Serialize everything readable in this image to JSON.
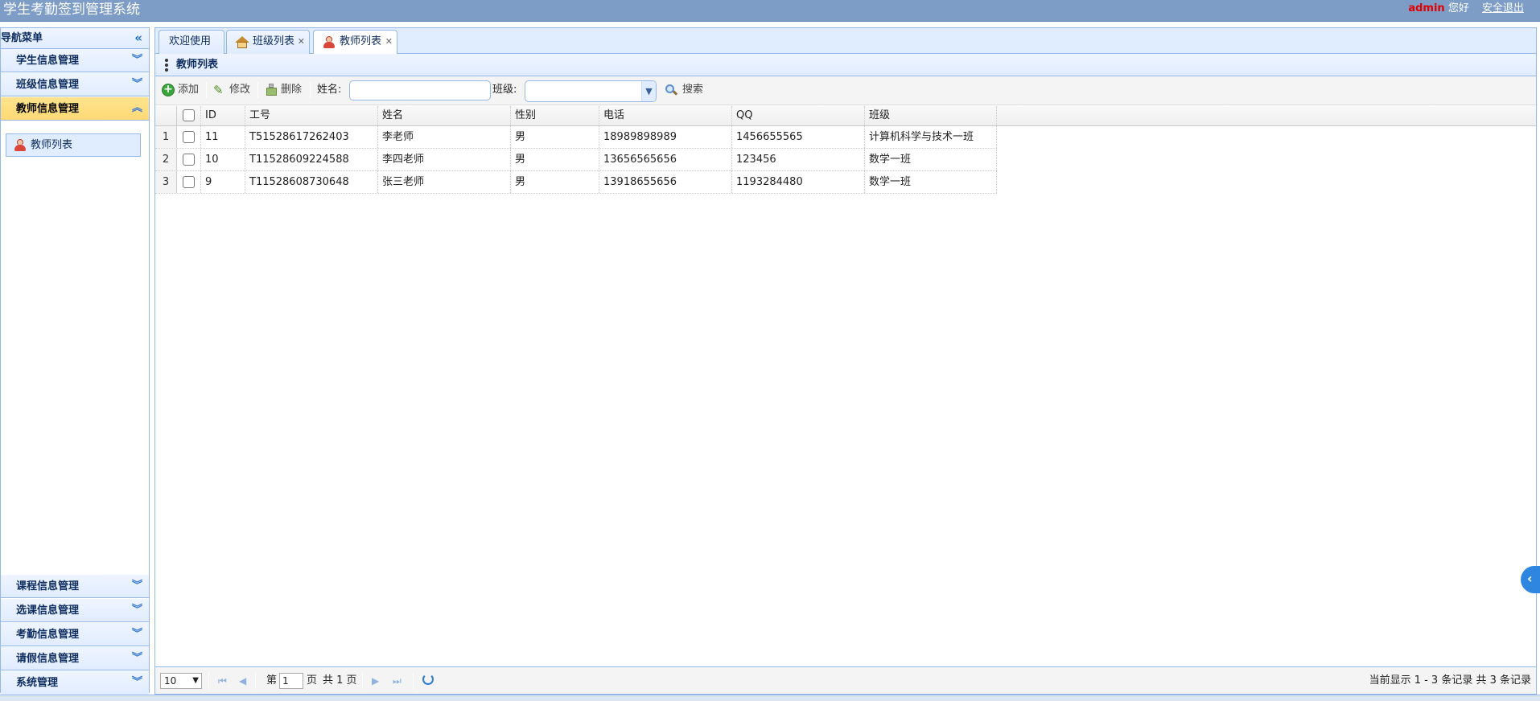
{
  "header": {
    "app_title": "学生考勤签到管理系统",
    "username": "admin",
    "greeting": "您好",
    "logout": "安全退出"
  },
  "nav": {
    "title": "导航菜单",
    "sections": [
      {
        "label": "学生信息管理"
      },
      {
        "label": "班级信息管理"
      },
      {
        "label": "教师信息管理",
        "active": true,
        "items": [
          {
            "label": "教师列表"
          }
        ]
      },
      {
        "label": "课程信息管理"
      },
      {
        "label": "选课信息管理"
      },
      {
        "label": "考勤信息管理"
      },
      {
        "label": "请假信息管理"
      },
      {
        "label": "系统管理"
      }
    ]
  },
  "tabs": [
    {
      "label": "欢迎使用",
      "closable": false
    },
    {
      "label": "班级列表",
      "closable": true,
      "icon": "house-icon"
    },
    {
      "label": "教师列表",
      "closable": true,
      "icon": "person-icon",
      "active": true
    }
  ],
  "panel": {
    "title": "教师列表"
  },
  "toolbar": {
    "add": "添加",
    "edit": "修改",
    "delete": "删除",
    "name_label": "姓名:",
    "name_value": "",
    "class_label": "班级:",
    "class_value": "",
    "search": "搜索"
  },
  "grid": {
    "columns": [
      "ID",
      "工号",
      "姓名",
      "性别",
      "电话",
      "QQ",
      "班级"
    ],
    "rows": [
      {
        "num": "1",
        "cells": [
          "11",
          "T51528617262403",
          "李老师",
          "男",
          "18989898989",
          "1456655565",
          "计算机科学与技术一班"
        ]
      },
      {
        "num": "2",
        "cells": [
          "10",
          "T11528609224588",
          "李四老师",
          "男",
          "13656565656",
          "123456",
          "数学一班"
        ]
      },
      {
        "num": "3",
        "cells": [
          "9",
          "T11528608730648",
          "张三老师",
          "男",
          "13918655656",
          "1193284480",
          "数学一班"
        ]
      }
    ]
  },
  "pager": {
    "page_size": "10",
    "page_prefix": "第",
    "current_page": "1",
    "page_suffix": "页",
    "total_pages_text": "共 1 页",
    "info": "当前显示 1 - 3 条记录 共 3 条记录"
  }
}
